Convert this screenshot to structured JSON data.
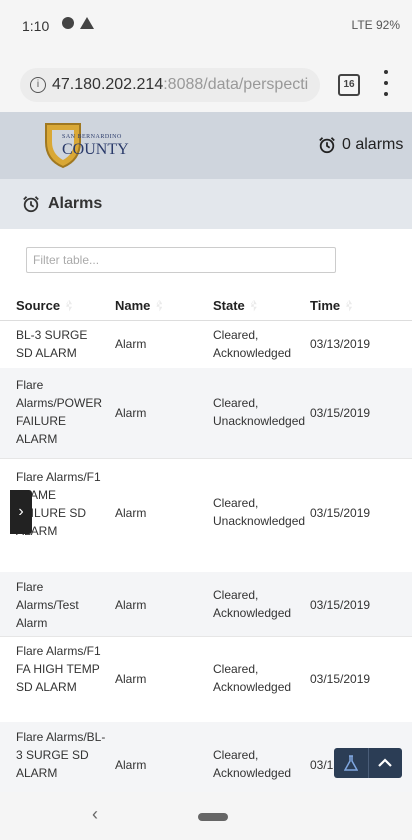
{
  "status_bar": {
    "time": "1:10",
    "right": "LTE 92%"
  },
  "browser": {
    "url_host": "47.180.202.214",
    "url_rest": ":8088/data/perspecti",
    "tab_count": "16"
  },
  "header": {
    "logo_small": "SAN BERNARDINO",
    "logo_big": "COUNTY",
    "alarm_count": "0 alarms"
  },
  "section": {
    "title": "Alarms"
  },
  "filter": {
    "placeholder": "Filter table..."
  },
  "table": {
    "columns": [
      "Source",
      "Name",
      "State",
      "Time"
    ],
    "rows": [
      {
        "source": "BL-3 SURGE SD ALARM",
        "name": "Alarm",
        "state": "Cleared, Acknowledged",
        "time": "03/13/2019"
      },
      {
        "source": "Flare Alarms/POWER FAILURE ALARM",
        "name": "Alarm",
        "state": "Cleared, Unacknowledged",
        "time": "03/15/2019"
      },
      {
        "source": "Flare Alarms/F1 FLAME FAILURE SD ALARM",
        "name": "Alarm",
        "state": "Cleared, Unacknowledged",
        "time": "03/15/2019"
      },
      {
        "source": "Flare Alarms/Test Alarm",
        "name": "Alarm",
        "state": "Cleared, Acknowledged",
        "time": "03/15/2019"
      },
      {
        "source": "Flare Alarms/F1 FA HIGH TEMP SD ALARM",
        "name": "Alarm",
        "state": "Cleared, Acknowledged",
        "time": "03/15/2019"
      },
      {
        "source": "Flare Alarms/BL-3 SURGE SD ALARM",
        "name": "Alarm",
        "state": "Cleared, Acknowledged",
        "time": "03/15/2019"
      }
    ]
  },
  "icons": {
    "drawer": "chevron-right-icon",
    "flask": "flask-icon",
    "up": "chevron-up-icon"
  }
}
